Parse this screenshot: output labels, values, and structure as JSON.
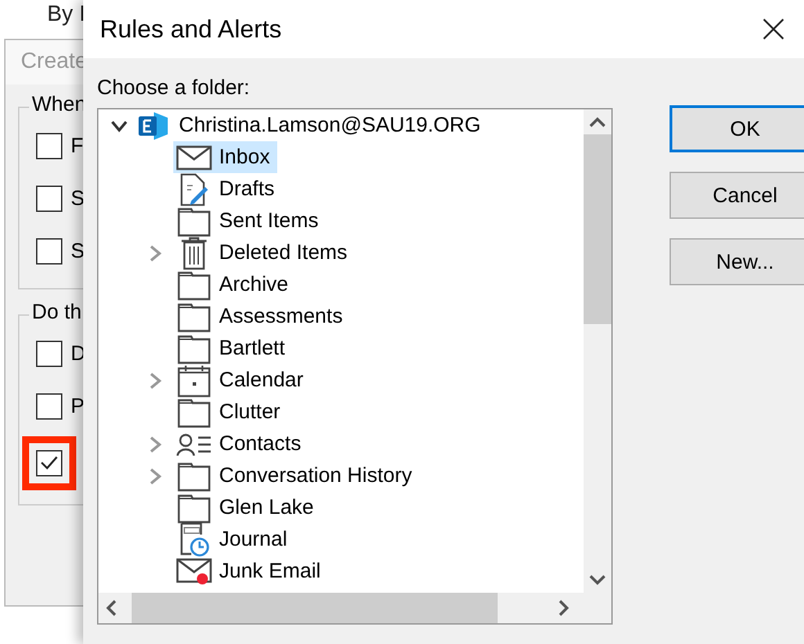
{
  "background_window": {
    "behind_text": "By I",
    "title": "Create",
    "groups": [
      {
        "label": "When",
        "rows": [
          {
            "label": "F",
            "checked": false,
            "highlighted": false
          },
          {
            "label": "S",
            "checked": false,
            "highlighted": false
          },
          {
            "label": "S",
            "checked": false,
            "highlighted": false
          }
        ]
      },
      {
        "label": "Do th",
        "rows": [
          {
            "label": "D",
            "checked": false,
            "highlighted": false
          },
          {
            "label": "P",
            "checked": false,
            "highlighted": false
          },
          {
            "checked": true,
            "highlighted": true
          }
        ]
      }
    ]
  },
  "dialog": {
    "title": "Rules and Alerts",
    "prompt": "Choose a folder:",
    "tree": {
      "label": "Christina.Lamson@SAU19.ORG",
      "expanded": true,
      "children": [
        {
          "label": "Inbox",
          "kind": "mail",
          "expandable": false,
          "selected": true
        },
        {
          "label": "Drafts",
          "kind": "draft",
          "expandable": false,
          "selected": false
        },
        {
          "label": "Sent Items",
          "kind": "folder",
          "expandable": false,
          "selected": false
        },
        {
          "label": "Deleted Items",
          "kind": "trash",
          "expandable": true,
          "selected": false
        },
        {
          "label": "Archive",
          "kind": "folder",
          "expandable": false,
          "selected": false
        },
        {
          "label": "Assessments",
          "kind": "folder",
          "expandable": false,
          "selected": false
        },
        {
          "label": "Bartlett",
          "kind": "folder",
          "expandable": false,
          "selected": false
        },
        {
          "label": "Calendar",
          "kind": "calendar",
          "expandable": true,
          "selected": false
        },
        {
          "label": "Clutter",
          "kind": "folder",
          "expandable": false,
          "selected": false
        },
        {
          "label": "Contacts",
          "kind": "contacts",
          "expandable": true,
          "selected": false
        },
        {
          "label": "Conversation History",
          "kind": "folder",
          "expandable": true,
          "selected": false
        },
        {
          "label": "Glen Lake",
          "kind": "folder",
          "expandable": false,
          "selected": false
        },
        {
          "label": "Journal",
          "kind": "journal",
          "expandable": false,
          "selected": false
        },
        {
          "label": "Junk Email",
          "kind": "junk",
          "expandable": false,
          "selected": false
        }
      ]
    },
    "buttons": [
      {
        "label": "OK",
        "default": true
      },
      {
        "label": "Cancel",
        "default": false
      },
      {
        "label": "New...",
        "default": false
      }
    ]
  }
}
